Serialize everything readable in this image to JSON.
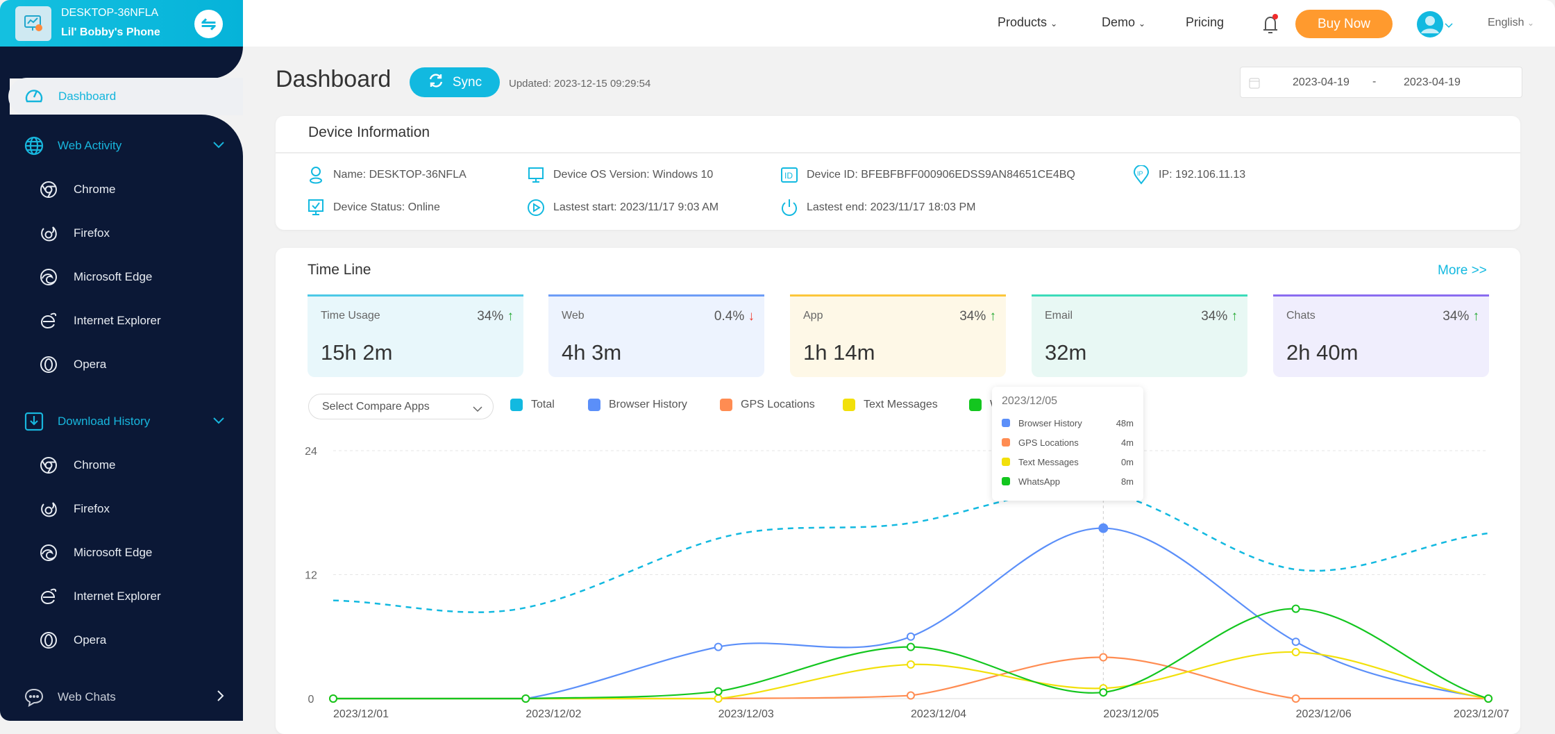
{
  "device": {
    "name": "DESKTOP-36NFLA",
    "label": "Lil' Bobby's Phone"
  },
  "sidebar": {
    "dashboard": "Dashboard",
    "web_activity": {
      "label": "Web Activity",
      "items": [
        "Chrome",
        "Firefox",
        "Microsoft Edge",
        "Internet Explorer",
        "Opera"
      ]
    },
    "download_history": {
      "label": "Download History",
      "items": [
        "Chrome",
        "Firefox",
        "Microsoft Edge",
        "Internet Explorer",
        "Opera"
      ]
    },
    "web_chats": "Web Chats"
  },
  "topnav": {
    "products": "Products",
    "demo": "Demo",
    "pricing": "Pricing",
    "buy_now": "Buy Now",
    "language": "English"
  },
  "header": {
    "title": "Dashboard",
    "sync": "Sync",
    "updated": "Updated: 2023-12-15 09:29:54",
    "date_from": "2023-04-19",
    "date_sep": "-",
    "date_to": "2023-04-19"
  },
  "device_info": {
    "title": "Device Information",
    "name": "Name: DESKTOP-36NFLA",
    "os": "Device OS Version: Windows 10",
    "id": "Device ID: BFEBFBFF000906EDSS9AN84651CE4BQ",
    "ip": "IP: 192.106.11.13",
    "status": "Device Status: Online",
    "last_start": "Lastest start: 2023/11/17 9:03 AM",
    "last_end": "Lastest end: 2023/11/17 18:03 PM"
  },
  "timeline": {
    "title": "Time Line",
    "more": "More >>",
    "compare_placeholder": "Select Compare Apps",
    "stats": [
      {
        "label": "Time Usage",
        "pct": "34%",
        "trend": "up",
        "value": "15h 2m",
        "color": "#4cc9e6",
        "bg": "#e8f7fb"
      },
      {
        "label": "Web",
        "pct": "0.4%",
        "trend": "down",
        "value": "4h 3m",
        "color": "#6d9cf7",
        "bg": "#edf3fe"
      },
      {
        "label": "App",
        "pct": "34%",
        "trend": "up",
        "value": "1h 14m",
        "color": "#fcc63a",
        "bg": "#fef8e7"
      },
      {
        "label": "Email",
        "pct": "34%",
        "trend": "up",
        "value": "32m",
        "color": "#3bdbb9",
        "bg": "#e8f8f4"
      },
      {
        "label": "Chats",
        "pct": "34%",
        "trend": "up",
        "value": "2h 40m",
        "color": "#8a6cf0",
        "bg": "#f0eefd"
      }
    ],
    "tooltip": {
      "date": "2023/12/05",
      "rows": [
        {
          "name": "Browser History",
          "value": "48m",
          "color": "#5b8ff9"
        },
        {
          "name": "GPS Locations",
          "value": "4m",
          "color": "#ff8c52"
        },
        {
          "name": "Text Messages",
          "value": "0m",
          "color": "#f2e00a"
        },
        {
          "name": "WhatsApp",
          "value": "8m",
          "color": "#13c61f"
        }
      ]
    }
  },
  "chart_data": {
    "type": "line",
    "categories": [
      "2023/12/01",
      "2023/12/02",
      "2023/12/03",
      "2023/12/04",
      "2023/12/05",
      "2023/12/06",
      "2023/12/07"
    ],
    "ylim": [
      0,
      24
    ],
    "yticks": [
      "0",
      "12",
      "24"
    ],
    "grid": true,
    "legend": "top-left",
    "series": [
      {
        "name": "Total",
        "color": "#12b9e0",
        "dashed": true,
        "values": [
          9.5,
          8.8,
          15.5,
          17,
          20,
          12.5,
          16
        ]
      },
      {
        "name": "Browser History",
        "color": "#5b8ff9",
        "values": [
          0,
          0,
          5,
          6,
          16.5,
          5.5,
          0
        ]
      },
      {
        "name": "GPS Locations",
        "color": "#ff8c52",
        "values": [
          0,
          0,
          0,
          0.3,
          4,
          0,
          0
        ]
      },
      {
        "name": "Text Messages",
        "color": "#f2e00a",
        "values": [
          0,
          0,
          0,
          3.3,
          1,
          4.5,
          0
        ]
      },
      {
        "name": "WhatsApp",
        "color": "#13c61f",
        "values": [
          0,
          0,
          0.7,
          5,
          0.6,
          8.7,
          0
        ]
      }
    ]
  }
}
